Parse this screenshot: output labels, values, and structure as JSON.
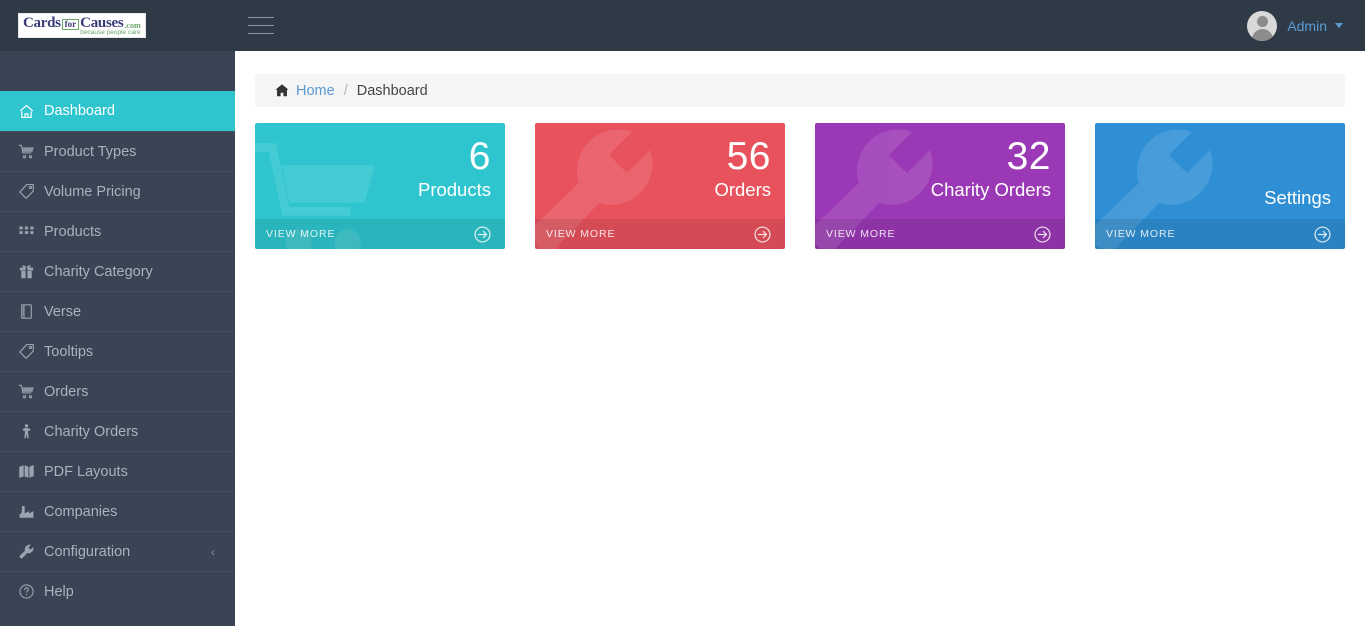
{
  "topbar": {
    "logo": {
      "cards": "Cards",
      "for": "for",
      "causes": "Causes",
      "com": ".com",
      "tagline": "because people care"
    },
    "menu_toggle_label": "Toggle navigation",
    "user": {
      "name": "Admin",
      "avatar_alt": "user-avatar"
    }
  },
  "sidebar": {
    "items": [
      {
        "label": "Dashboard",
        "icon": "home-icon",
        "active": true,
        "has_submenu": false
      },
      {
        "label": "Product Types",
        "icon": "shopping-cart-icon",
        "active": false,
        "has_submenu": false
      },
      {
        "label": "Volume Pricing",
        "icon": "tag-icon",
        "active": false,
        "has_submenu": false
      },
      {
        "label": "Products",
        "icon": "grid-icon",
        "active": false,
        "has_submenu": false
      },
      {
        "label": "Charity Category",
        "icon": "gift-icon",
        "active": false,
        "has_submenu": false
      },
      {
        "label": "Verse",
        "icon": "book-icon",
        "active": false,
        "has_submenu": false
      },
      {
        "label": "Tooltips",
        "icon": "tag-icon",
        "active": false,
        "has_submenu": false
      },
      {
        "label": "Orders",
        "icon": "shopping-cart-icon",
        "active": false,
        "has_submenu": false
      },
      {
        "label": "Charity Orders",
        "icon": "person-icon",
        "active": false,
        "has_submenu": false
      },
      {
        "label": "PDF Layouts",
        "icon": "map-icon",
        "active": false,
        "has_submenu": false
      },
      {
        "label": "Companies",
        "icon": "factory-icon",
        "active": false,
        "has_submenu": false
      },
      {
        "label": "Configuration",
        "icon": "wrench-icon",
        "active": false,
        "has_submenu": true
      },
      {
        "label": "Help",
        "icon": "question-circle-icon",
        "active": false,
        "has_submenu": false
      }
    ],
    "submenu_chevron": "‹"
  },
  "breadcrumb": {
    "home_icon": "home-icon",
    "home": "Home",
    "separator": "/",
    "current": "Dashboard"
  },
  "cards": [
    {
      "value": "6",
      "label": "Products",
      "footer": "VIEW MORE",
      "color": "#2ec5ce",
      "icon": "shopping-cart-icon",
      "arrow_icon": "arrow-circle-right-icon"
    },
    {
      "value": "56",
      "label": "Orders",
      "footer": "VIEW MORE",
      "color": "#e8525d",
      "icon": "wrench-icon",
      "arrow_icon": "arrow-circle-right-icon"
    },
    {
      "value": "32",
      "label": "Charity Orders",
      "footer": "VIEW MORE",
      "color": "#9b38b5",
      "icon": "wrench-icon",
      "arrow_icon": "arrow-circle-right-icon"
    },
    {
      "value": "",
      "label": "Settings",
      "footer": "VIEW MORE",
      "color": "#2f8fd4",
      "icon": "wrench-icon",
      "arrow_icon": "arrow-circle-right-icon"
    }
  ],
  "theme": {
    "topbar_bg": "#2f3a47",
    "sidebar_bg": "#3a4454",
    "accent": "#2ec5ce",
    "link": "#5b9bd5",
    "content_bg": "#ffffff",
    "breadcrumb_bg": "#f5f5f5"
  }
}
